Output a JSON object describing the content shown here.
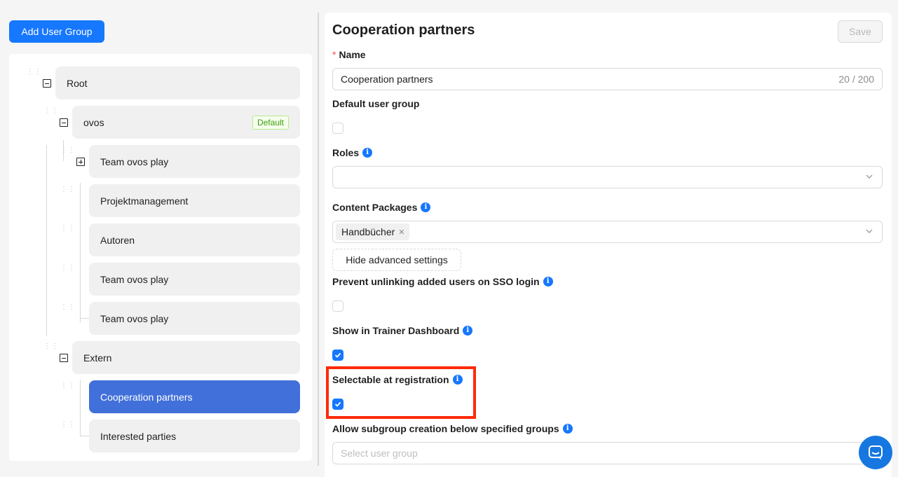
{
  "add_group_label": "Add User Group",
  "tree": {
    "root": {
      "label": "Root"
    },
    "ovos": {
      "label": "ovos",
      "badge": "Default"
    },
    "team_ovos_play_1": {
      "label": "Team ovos play"
    },
    "projektmanagement": {
      "label": "Projektmanagement"
    },
    "autoren": {
      "label": "Autoren"
    },
    "team_ovos_play_2": {
      "label": "Team ovos play"
    },
    "team_ovos_play_3": {
      "label": "Team ovos play"
    },
    "extern": {
      "label": "Extern"
    },
    "cooperation_partners": {
      "label": "Cooperation partners"
    },
    "interested_parties": {
      "label": "Interested parties"
    }
  },
  "form": {
    "title": "Cooperation partners",
    "save_label": "Save",
    "name_label": "Name",
    "name_value": "Cooperation partners",
    "name_count": "20 / 200",
    "default_group_label": "Default user group",
    "roles_label": "Roles",
    "content_packages_label": "Content Packages",
    "content_package_tag": "Handbücher",
    "hide_advanced_label": "Hide advanced settings",
    "prevent_unlink_label": "Prevent unlinking added users on SSO login",
    "trainer_dashboard_label": "Show in Trainer Dashboard",
    "selectable_registration_label": "Selectable at registration",
    "allow_subgroup_label": "Allow subgroup creation below specified groups",
    "subgroup_placeholder": "Select user group"
  },
  "checkboxes": {
    "default_group": false,
    "prevent_unlink": false,
    "trainer_dashboard": true,
    "selectable_registration": true
  },
  "colors": {
    "primary": "#1677ff",
    "selected_node": "#4170da",
    "highlight": "#ff2a0a",
    "default_badge": "#389e0d"
  },
  "icons": {
    "info": "info-circle-icon",
    "chevron": "chevron-down-icon",
    "drag": "drag-handle-icon",
    "collapse": "minus-square-icon",
    "expand": "plus-square-icon",
    "chat": "chat-bubble-icon"
  }
}
